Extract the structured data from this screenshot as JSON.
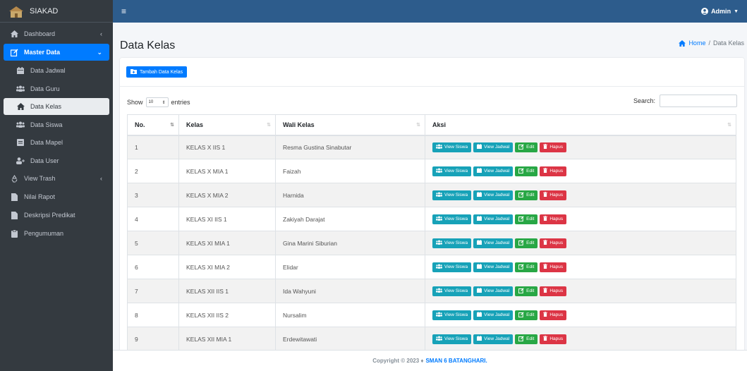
{
  "brand": {
    "name": "SIAKAD"
  },
  "sidebar": {
    "items": [
      {
        "label": "Dashboard",
        "icon": "home-icon",
        "arrow": "‹"
      },
      {
        "label": "Master Data",
        "icon": "edit-icon",
        "arrow": "⌄"
      },
      {
        "label": "Data Jadwal",
        "icon": "calendar-icon"
      },
      {
        "label": "Data Guru",
        "icon": "users-icon"
      },
      {
        "label": "Data Kelas",
        "icon": "home-icon"
      },
      {
        "label": "Data Siswa",
        "icon": "users-icon"
      },
      {
        "label": "Data Mapel",
        "icon": "book-icon"
      },
      {
        "label": "Data User",
        "icon": "user-plus-icon"
      },
      {
        "label": "View Trash",
        "icon": "recycle-icon",
        "arrow": "‹"
      },
      {
        "label": "Nilai Rapot",
        "icon": "file-icon"
      },
      {
        "label": "Deskripsi Predikat",
        "icon": "file-icon"
      },
      {
        "label": "Pengumuman",
        "icon": "clipboard-icon"
      }
    ]
  },
  "topbar": {
    "user": "Admin"
  },
  "page": {
    "title": "Data Kelas",
    "breadcrumb_home": "Home",
    "breadcrumb_sep": "/",
    "breadcrumb_current": "Data Kelas"
  },
  "toolbar": {
    "add_label": "Tambah Data Kelas"
  },
  "table_controls": {
    "show_label": "Show",
    "entries_value": "10",
    "entries_label": "entries",
    "search_label": "Search:"
  },
  "table": {
    "headers": [
      "No.",
      "Kelas",
      "Wali Kelas",
      "Aksi"
    ],
    "action_labels": {
      "view_siswa": "View Siswa",
      "view_jadwal": "View Jadwal",
      "edit": "Edit",
      "hapus": "Hapus"
    },
    "rows": [
      {
        "no": "1",
        "kelas": "KELAS X IIS 1",
        "wali": "Resma Gustina Sinabutar"
      },
      {
        "no": "2",
        "kelas": "KELAS X MIA 1",
        "wali": "Faizah"
      },
      {
        "no": "3",
        "kelas": "KELAS X MIA 2",
        "wali": "Harnida"
      },
      {
        "no": "4",
        "kelas": "KELAS XI IIS 1",
        "wali": "Zakiyah Darajat"
      },
      {
        "no": "5",
        "kelas": "KELAS XI MIA 1",
        "wali": "Gina Marini Siburian"
      },
      {
        "no": "6",
        "kelas": "KELAS XI MIA 2",
        "wali": "Elidar"
      },
      {
        "no": "7",
        "kelas": "KELAS XII IIS 1",
        "wali": "Ida Wahyuni"
      },
      {
        "no": "8",
        "kelas": "KELAS XII IIS 2",
        "wali": "Nursalim"
      },
      {
        "no": "9",
        "kelas": "KELAS XII MIA 1",
        "wali": "Erdewitawati"
      }
    ]
  },
  "footer": {
    "copyright": "Copyright © 2023 ♦",
    "school": "SMAN 6 BATANGHARI."
  },
  "colors": {
    "topbar": "#2d5c8c",
    "sidebar": "#343a40",
    "primary": "#007bff",
    "info": "#17a2b8",
    "success": "#28a745",
    "danger": "#dc3545"
  }
}
